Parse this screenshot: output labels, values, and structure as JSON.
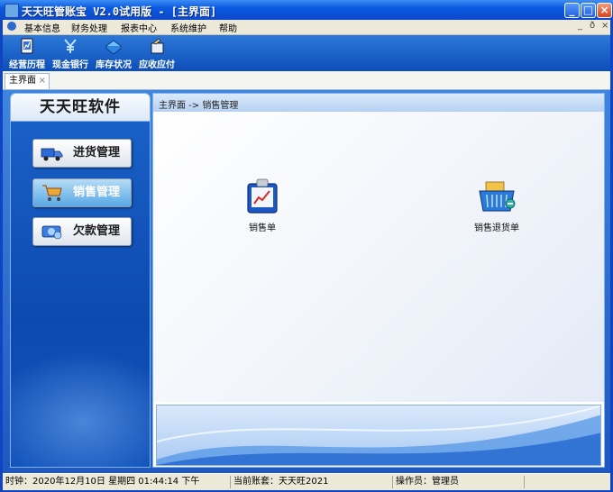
{
  "window": {
    "title": "天天旺管账宝 V2.0试用版 - [主界面]"
  },
  "menu": {
    "items": [
      "基本信息",
      "财务处理",
      "报表中心",
      "系统维护",
      "帮助"
    ],
    "mdi_controls": [
      "_",
      "ð",
      "×"
    ]
  },
  "toolbar": {
    "items": [
      {
        "label": "经营历程",
        "icon": "history-book-icon"
      },
      {
        "label": "现金银行",
        "icon": "cash-bank-icon"
      },
      {
        "label": "库存状况",
        "icon": "inventory-icon"
      },
      {
        "label": "应收应付",
        "icon": "receivable-icon"
      }
    ]
  },
  "tab": {
    "label": "主界面",
    "close": "×"
  },
  "sidebar": {
    "brand": "天天旺软件",
    "buttons": [
      {
        "label": "进货管理",
        "active": false,
        "icon": "truck-icon"
      },
      {
        "label": "销售管理",
        "active": true,
        "icon": "shopping-cart-icon"
      },
      {
        "label": "欠款管理",
        "active": false,
        "icon": "money-icon"
      }
    ]
  },
  "main": {
    "breadcrumb": "主界面 -> 销售管理",
    "functions": [
      {
        "label": "销售单",
        "icon": "sales-order-icon"
      },
      {
        "label": "销售退货单",
        "icon": "sales-return-icon"
      }
    ]
  },
  "status": {
    "clock": "时钟：2020年12月10日 星期四 01:44:14 下午",
    "account": "当前账套：天天旺2021",
    "operator": "操作员：管理员"
  },
  "colors": {
    "title_bar": "#0a5ae0",
    "toolbar": "#1a60c8",
    "accent": "#0d4ab0"
  }
}
